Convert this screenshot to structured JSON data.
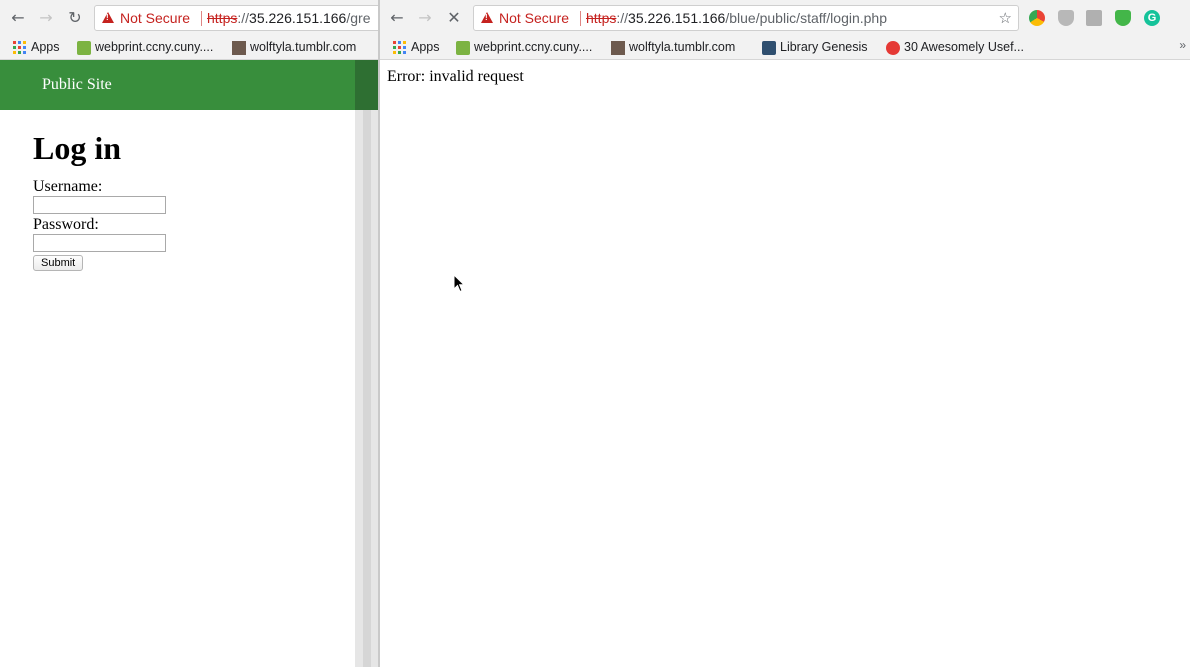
{
  "left_window": {
    "toolbar": {
      "back_icon": "arrow-left-icon",
      "forward_icon": "arrow-right-icon",
      "reload_icon": "reload-icon",
      "security_label": "Not Secure",
      "url_scheme": "https",
      "url_sep": "://",
      "url_host": "35.226.151.166",
      "url_path": "/gre"
    },
    "bookmarks": [
      {
        "label": "Apps",
        "icon": "apps-grid-icon"
      },
      {
        "label": "webprint.ccny.cuny....",
        "icon": "webprint-icon"
      },
      {
        "label": "wolftyla.tumblr.com",
        "icon": "tumblr-avatar-icon"
      }
    ],
    "header": {
      "link_label": "Public Site"
    },
    "form": {
      "title": "Log in",
      "username_label": "Username:",
      "username_value": "",
      "password_label": "Password:",
      "password_value": "",
      "submit_label": "Submit"
    }
  },
  "right_window": {
    "toolbar": {
      "back_icon": "arrow-left-icon",
      "forward_icon": "arrow-right-icon",
      "stop_icon": "close-icon",
      "security_label": "Not Secure",
      "url_scheme": "https",
      "url_sep": "://",
      "url_host": "35.226.151.166",
      "url_path": "/blue/public/staff/login.php",
      "bookmark_star_icon": "star-icon",
      "extensions": [
        "chrome-extension-icon",
        "shield-icon",
        "puzzle-icon",
        "vpn-shield-icon",
        "grammarly-icon"
      ]
    },
    "bookmarks": [
      {
        "label": "Apps",
        "icon": "apps-grid-icon"
      },
      {
        "label": "webprint.ccny.cuny....",
        "icon": "webprint-icon"
      },
      {
        "label": "wolftyla.tumblr.com",
        "icon": "tumblr-avatar-icon"
      },
      {
        "label": "Library Genesis",
        "icon": "library-icon"
      },
      {
        "label": "30 Awesomely Usef...",
        "icon": "trending-icon"
      }
    ],
    "overflow_label": "»",
    "content": {
      "message": "Error: invalid request"
    }
  },
  "colors": {
    "brand_green": "#388e3c",
    "insecure_red": "#c5221f",
    "chrome_bg": "#f2f2f2"
  }
}
